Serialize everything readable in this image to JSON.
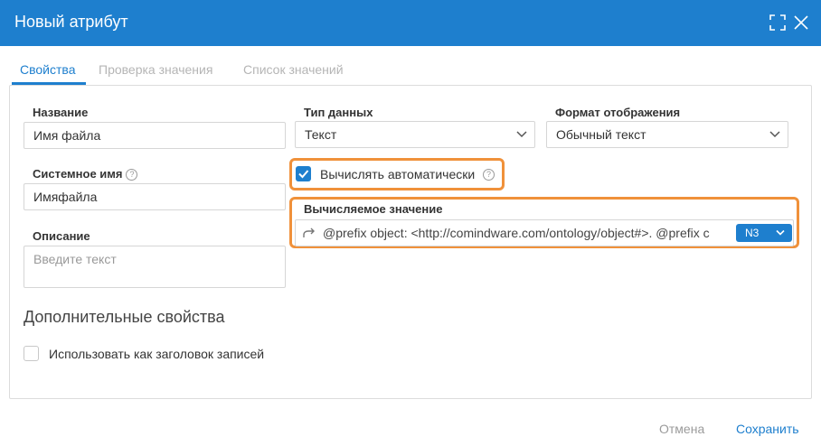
{
  "dialog": {
    "title": "Новый атрибут"
  },
  "tabs": [
    {
      "label": "Свойства",
      "active": true
    },
    {
      "label": "Проверка значения",
      "active": false
    },
    {
      "label": "Список значений",
      "active": false
    }
  ],
  "form": {
    "name": {
      "label": "Название",
      "value": "Имя файла"
    },
    "system_name": {
      "label": "Системное имя",
      "value": "Имяфайла",
      "help": "?"
    },
    "description": {
      "label": "Описание",
      "placeholder": "Введите текст"
    },
    "data_type": {
      "label": "Тип данных",
      "value": "Текст"
    },
    "display_format": {
      "label": "Формат отображения",
      "value": "Обычный текст"
    },
    "auto_calc": {
      "label": "Вычислять автоматически",
      "checked": true,
      "help": "?"
    },
    "computed_value": {
      "label": "Вычисляемое значение",
      "value": "@prefix object: <http://comindware.com/ontology/object#>. @prefix c",
      "format": "N3"
    }
  },
  "additional": {
    "title": "Дополнительные свойства",
    "use_as_header": {
      "label": "Использовать как заголовок записей",
      "checked": false
    }
  },
  "footer": {
    "cancel_label": "Отмена",
    "save_label": "Сохранить"
  },
  "colors": {
    "header_bg": "#1e7fce",
    "accent": "#1e7fce",
    "highlight": "#f0913a"
  },
  "icons": {
    "maximize": "maximize-icon",
    "close": "close-icon",
    "chevron": "chevron-down-icon",
    "redirect": "redirect-arrow-icon",
    "check": "checkmark-icon"
  }
}
